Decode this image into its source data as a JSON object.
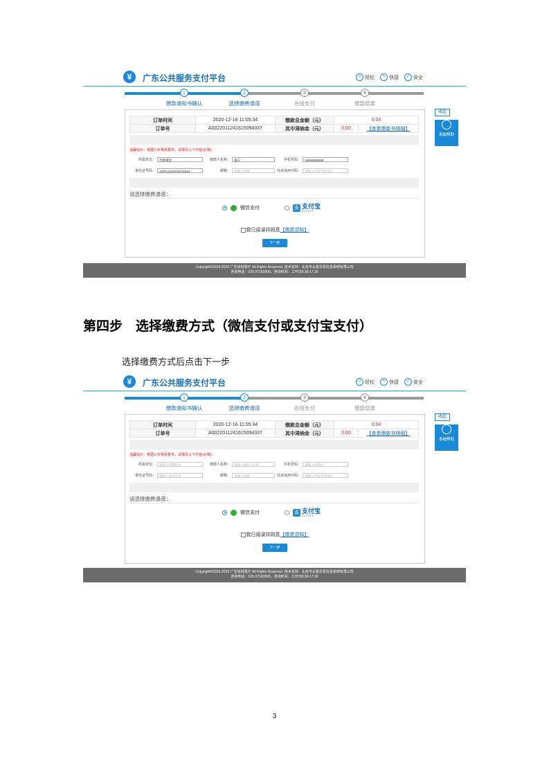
{
  "header": {
    "logo_glyph": "¥",
    "title": "广东公共服务支付平台",
    "icons": [
      {
        "label": "轻松",
        "icon": "smile-icon"
      },
      {
        "label": "快捷",
        "icon": "bolt-icon"
      },
      {
        "label": "安全",
        "icon": "shield-icon"
      }
    ]
  },
  "steps": [
    {
      "num": "1",
      "label": "缴款通知书确认",
      "active": true
    },
    {
      "num": "2",
      "label": "选择缴费通道",
      "active": true
    },
    {
      "num": "3",
      "label": "在线支付",
      "active": false
    },
    {
      "num": "4",
      "label": "缴款结果",
      "active": false
    }
  ],
  "order": {
    "time_label": "订单时间",
    "time_value": "2020-12-16 11:05:34",
    "total_label": "缴款总金额（元）",
    "total_value": "0.04",
    "no_label": "订单号",
    "no_value": "A0022011241615094337",
    "late_label": "其中滞纳金（元）",
    "late_value": "0.00",
    "detail_link": "【查看缴款书明细】"
  },
  "form": {
    "warning": "温馨提示：根据三折相关要求，请填写以下内容(必填)：",
    "unit_label": "所属单位：",
    "payer_label": "缴款人名称：",
    "phone_label": "手机号码：",
    "id_label": "身份证号码：",
    "email_label": "邮箱：",
    "credit_label": "社会信用代码：",
    "filled": {
      "unit": "示例单位",
      "payer": "张三",
      "phone": "18888888888",
      "id": "110011202010016354",
      "email": "请输入邮箱",
      "credit": "请输入社会信用代码"
    },
    "empty": {
      "unit": "请输入所属单位",
      "payer": "请输入缴款人名称",
      "phone": "请输入手机号",
      "id": "请输入身份证号",
      "email": "请输入邮箱",
      "credit": "请输入社会信用代码"
    }
  },
  "channel": {
    "title": "请选择缴费通道：",
    "wechat": "微信支付",
    "alipay": "支付宝",
    "alipay_sub": "ALIPAY"
  },
  "agree": {
    "text": "我已阅读并同意",
    "link": "【缴费须知】"
  },
  "next_button": "下一步",
  "help": {
    "collapse": "收起",
    "label": "系统帮助"
  },
  "footer": {
    "line1": "Copyright©2016-2020 广东省财政厅 All Rights Reserved. 技术支持：北京市太极华青信息系统有限公司",
    "line2": "咨询电话：020-37162800。咨询时间：工作日8:30-17:30"
  },
  "doc": {
    "heading": "第四步　选择缴费方式（微信支付或支付宝支付）",
    "subtitle": "选择缴费方式后点击下一步",
    "page_number": "3"
  }
}
